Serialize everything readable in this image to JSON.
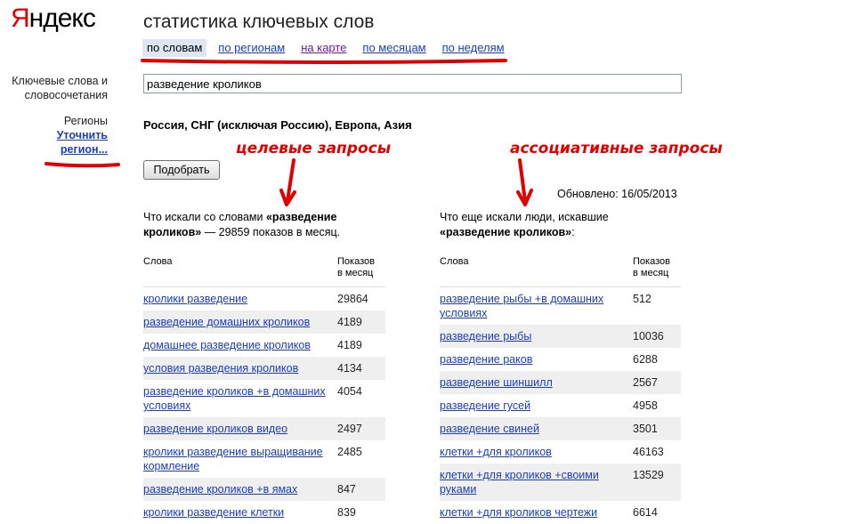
{
  "logo": {
    "y": "Я",
    "rest": "ндекс"
  },
  "title": "статистика ключевых слов",
  "tabs": [
    {
      "label": "по словам"
    },
    {
      "label": "по регионам"
    },
    {
      "label": "на карте"
    },
    {
      "label": "по месяцам"
    },
    {
      "label": "по неделям"
    }
  ],
  "sidebar": {
    "keywords_label_1": "Ключевые слова и",
    "keywords_label_2": "словосочетания",
    "regions_label": "Регионы",
    "refine_1": "Уточнить",
    "refine_2": "регион..."
  },
  "search": {
    "value": "разведение кроликов"
  },
  "regions_text": "Россия, СНГ (исключая Россию), Европа, Азия",
  "submit_label": "Подобрать",
  "updated": "Обновлено: 16/05/2013",
  "annotations": {
    "target": "целевые запросы",
    "assoc": "ассоциативные запросы"
  },
  "left": {
    "title_a": "Что искали со словами ",
    "title_b": "«разведение кроликов»",
    "title_c": " — 29859 показов в месяц.",
    "col_words": "Слова",
    "col_shows_1": "Показов",
    "col_shows_2": "в месяц",
    "rows": [
      {
        "word": "кролики разведение",
        "count": "29864"
      },
      {
        "word": "разведение домашних кроликов",
        "count": "4189"
      },
      {
        "word": "домашнее разведение кроликов",
        "count": "4189"
      },
      {
        "word": "условия разведения кроликов",
        "count": "4134"
      },
      {
        "word": "разведение кроликов +в домашних условиях",
        "count": "4054"
      },
      {
        "word": "разведение кроликов видео",
        "count": "2497"
      },
      {
        "word": "кролики разведение выращивание кормление",
        "count": "2485"
      },
      {
        "word": "разведение кроликов +в ямах",
        "count": "847"
      },
      {
        "word": "кролики разведение клетки",
        "count": "839"
      }
    ]
  },
  "right": {
    "title_a": "Что еще искали люди, искавшие ",
    "title_b": "«разведение кроликов»",
    "title_c": ":",
    "col_words": "Слова",
    "col_shows_1": "Показов",
    "col_shows_2": "в месяц",
    "rows": [
      {
        "word": "разведение рыбы +в домашних условиях",
        "count": "512"
      },
      {
        "word": "разведение рыбы",
        "count": "10036"
      },
      {
        "word": "разведение раков",
        "count": "6288"
      },
      {
        "word": "разведение шиншилл",
        "count": "2567"
      },
      {
        "word": "разведение гусей",
        "count": "4958"
      },
      {
        "word": "разведение свиней",
        "count": "3501"
      },
      {
        "word": "клетки +для кроликов",
        "count": "46163"
      },
      {
        "word": "клетки +для кроликов +своими руками",
        "count": "13529"
      },
      {
        "word": "клетки +для кроликов чертежи",
        "count": "6614"
      }
    ]
  }
}
